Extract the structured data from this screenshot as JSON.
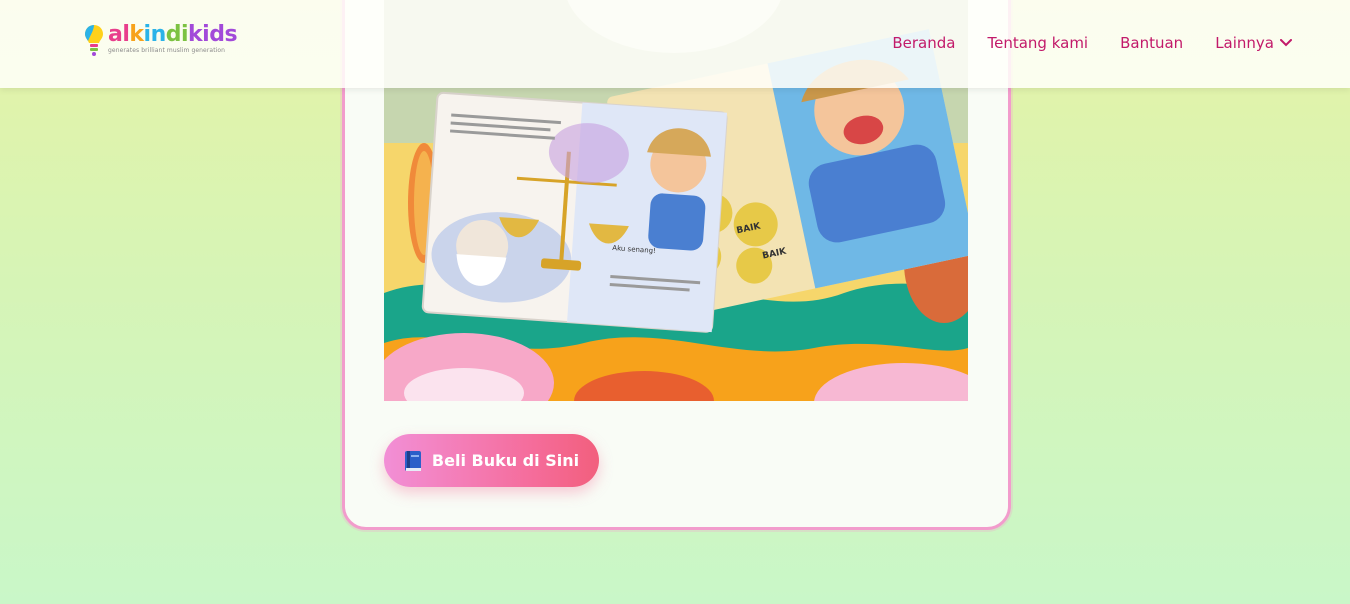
{
  "brand": {
    "name_parts": [
      "al",
      "k",
      "in",
      "di",
      "kids"
    ],
    "tagline": "generates brilliant muslim generation"
  },
  "nav": {
    "items": [
      {
        "label": "Beranda"
      },
      {
        "label": "Tentang kami"
      },
      {
        "label": "Bantuan"
      },
      {
        "label": "Lainnya",
        "has_dropdown": true
      }
    ]
  },
  "card": {
    "image_icon": "book-illustration",
    "buy_button": {
      "icon": "book-icon",
      "label": "Beli Buku di Sini"
    },
    "book_text": {
      "word_good": "BAIK",
      "speech": "Aku senang!"
    }
  },
  "colors": {
    "accent": "#c21a6a",
    "card_border": "#f29ccc",
    "button_start": "#f28fd6",
    "button_end": "#f25f7d"
  }
}
